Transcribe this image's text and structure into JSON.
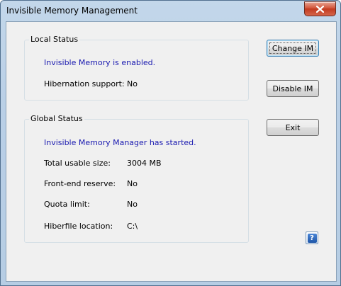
{
  "window": {
    "title": "Invisible Memory Management"
  },
  "local_status": {
    "group_title": "Local Status",
    "status_text": "Invisible Memory is enabled.",
    "rows": [
      {
        "label": "Hibernation support:",
        "value": "No"
      }
    ]
  },
  "global_status": {
    "group_title": "Global Status",
    "status_text": "Invisible Memory Manager has started.",
    "rows": [
      {
        "label": "Total usable size:",
        "value": "3004 MB"
      },
      {
        "label": "Front-end reserve:",
        "value": "No"
      },
      {
        "label": "Quota limit:",
        "value": "No"
      },
      {
        "label": "Hiberfile location:",
        "value": "C:\\"
      }
    ]
  },
  "buttons": {
    "change_label": "Change IM",
    "disable_label": "Disable IM",
    "exit_label": "Exit"
  },
  "icons": {
    "close": "close-icon",
    "help": "help-icon"
  },
  "colors": {
    "status_text": "#1a1ab0",
    "close_button": "#c23a1f",
    "title_bar": "#b9cfe6"
  }
}
